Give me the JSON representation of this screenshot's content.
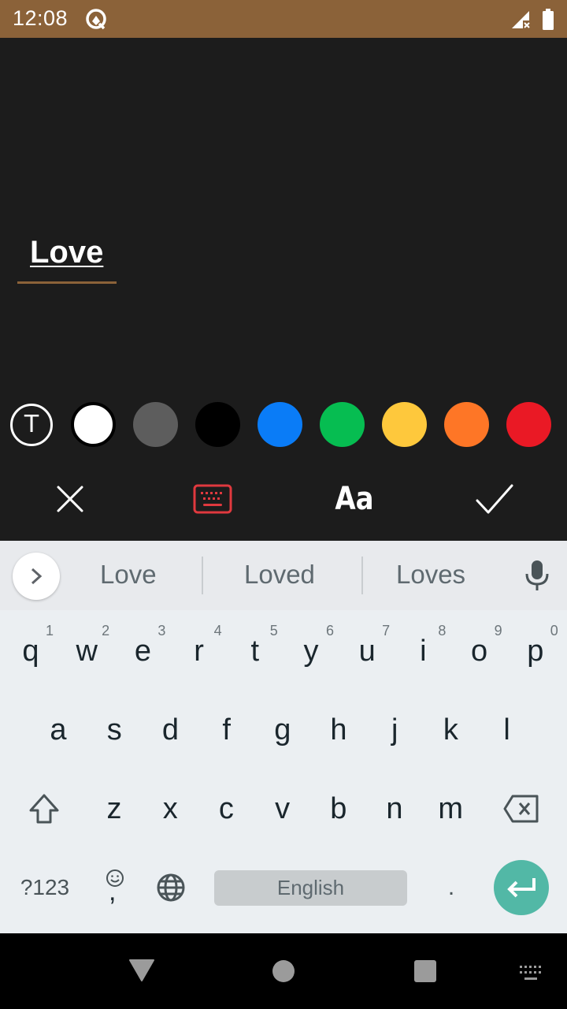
{
  "status_bar": {
    "time": "12:08",
    "icons": [
      "app-notification-icon",
      "signal-no-service-icon",
      "battery-full-icon"
    ],
    "background": "#8b6239"
  },
  "editor": {
    "text_value": "Love",
    "text_color": "#ffffff",
    "accent_color": "#8b6239"
  },
  "palette": {
    "text_style_label": "T",
    "colors": [
      {
        "name": "white",
        "hex": "#ffffff",
        "selected": true
      },
      {
        "name": "gray",
        "hex": "#5d5d5d",
        "selected": false
      },
      {
        "name": "black",
        "hex": "#000000",
        "selected": false
      },
      {
        "name": "blue",
        "hex": "#0a7cf7",
        "selected": false
      },
      {
        "name": "green",
        "hex": "#06bd51",
        "selected": false
      },
      {
        "name": "yellow",
        "hex": "#fec83c",
        "selected": false
      },
      {
        "name": "orange",
        "hex": "#fe7626",
        "selected": false
      },
      {
        "name": "red",
        "hex": "#ea1925",
        "selected": false
      }
    ]
  },
  "toolbar": {
    "close": "close-icon",
    "keyboard": "keyboard-icon",
    "font_label": "Aa",
    "confirm": "check-icon",
    "keyboard_active_color": "#e0393e"
  },
  "keyboard": {
    "suggestions": [
      "Love",
      "Loved",
      "Loves"
    ],
    "row1": [
      {
        "key": "q",
        "hint": "1"
      },
      {
        "key": "w",
        "hint": "2"
      },
      {
        "key": "e",
        "hint": "3"
      },
      {
        "key": "r",
        "hint": "4"
      },
      {
        "key": "t",
        "hint": "5"
      },
      {
        "key": "y",
        "hint": "6"
      },
      {
        "key": "u",
        "hint": "7"
      },
      {
        "key": "i",
        "hint": "8"
      },
      {
        "key": "o",
        "hint": "9"
      },
      {
        "key": "p",
        "hint": "0"
      }
    ],
    "row2": [
      "a",
      "s",
      "d",
      "f",
      "g",
      "h",
      "j",
      "k",
      "l"
    ],
    "row3": [
      "z",
      "x",
      "c",
      "v",
      "b",
      "n",
      "m"
    ],
    "symbols_label": "?123",
    "comma_label": ",",
    "space_label": "English",
    "period_label": ".",
    "enter_color": "#52b8a6"
  },
  "nav_bar": {
    "items": [
      "back-icon",
      "home-icon",
      "recents-icon",
      "keyboard-switch-icon"
    ]
  }
}
